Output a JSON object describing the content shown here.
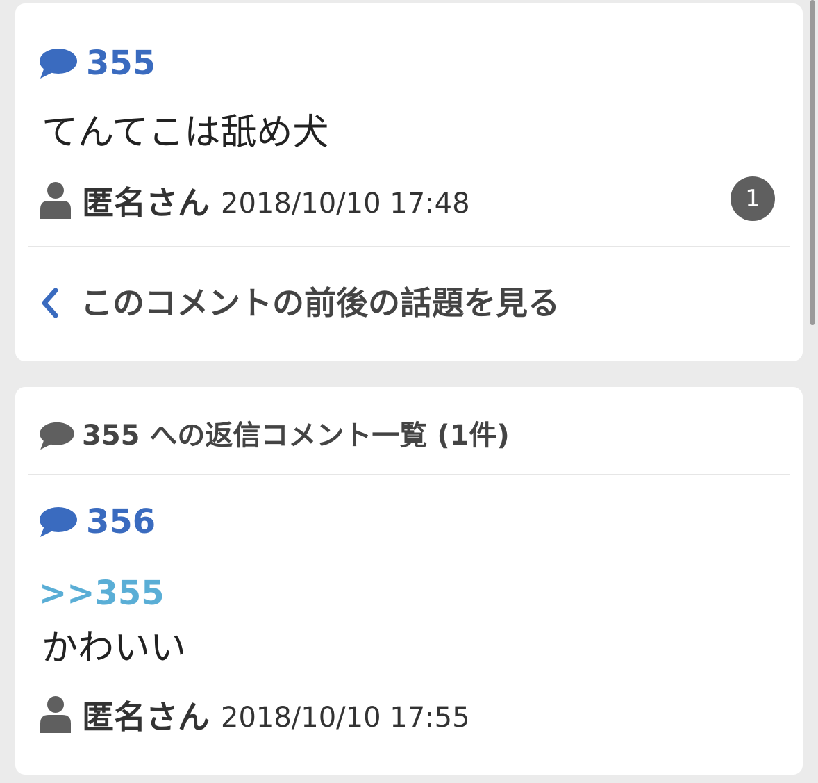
{
  "main_comment": {
    "number": "355",
    "text": "てんてこは舐め犬",
    "author": "匿名さん",
    "date": "2018/10/10 17:48",
    "reply_count": "1",
    "context_link_label": "このコメントの前後の話題を見る"
  },
  "replies_section": {
    "header_label": "355 への返信コメント一覧 (1件)",
    "items": [
      {
        "number": "356",
        "anchor": ">>355",
        "text": "かわいい",
        "author": "匿名さん",
        "date": "2018/10/10 17:55"
      }
    ]
  },
  "icons": {
    "comment": "speech-bubble-icon",
    "user": "person-icon",
    "back": "chevron-left-icon"
  },
  "colors": {
    "background": "#ebebeb",
    "card": "#ffffff",
    "comment_number": "#3a6bbf",
    "anchor_link": "#5aaed6",
    "badge": "#5f5f5f",
    "icon_gray": "#5f5f5f"
  }
}
